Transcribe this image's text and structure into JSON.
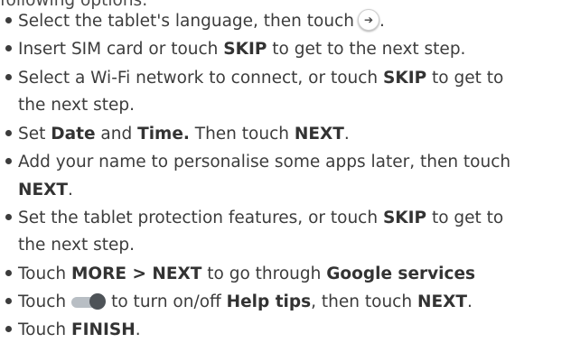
{
  "intro_text": "following options:",
  "steps": [
    {
      "pre": "Select the tablet's language, then touch",
      "icon": "arrow-right-circle-icon",
      "post": "."
    },
    {
      "pre": "Insert SIM card or touch ",
      "bold": "SKIP",
      "post": " to get to the next step."
    },
    {
      "line1_pre": "Select a Wi-Fi network to connect, or touch ",
      "line1_bold": "SKIP",
      "line1_post": " to get to",
      "line2": "the next step."
    },
    {
      "pre": "Set ",
      "bold1": "Date",
      "mid1": " and ",
      "bold2": "Time.",
      "mid2": " Then touch ",
      "bold3": "NEXT",
      "post": "."
    },
    {
      "line1": "Add your name to personalise some apps later, then touch",
      "line2_bold": "NEXT",
      "line2_post": "."
    },
    {
      "line1_pre": "Set the tablet protection features, or touch ",
      "line1_bold": "SKIP",
      "line1_post": " to get to",
      "line2": "the next step."
    },
    {
      "pre": "Touch ",
      "bold1": "MORE > NEXT",
      "mid": " to go through ",
      "bold2": "Google services"
    },
    {
      "pre": "Touch",
      "icon": "toggle-switch-icon",
      "mid": "to turn on/off ",
      "bold1": "Help tips",
      "mid2": ", then touch ",
      "bold2": "NEXT",
      "post": "."
    },
    {
      "pre": "Touch ",
      "bold": "FINISH",
      "post": "."
    }
  ]
}
